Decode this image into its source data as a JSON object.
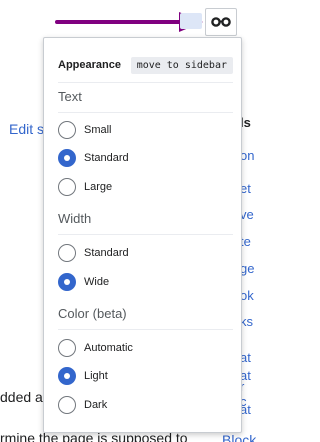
{
  "page": {
    "edit_link": "Edit so",
    "text_fragment_1": "dded a r",
    "text_fragment_2": "rmine the page is supposed to",
    "block_link": "Block",
    "right_col_heading": "ls",
    "right_col_items": [
      "on",
      "et",
      "ve",
      "te",
      "ge",
      "ok",
      "ks",
      "at",
      "at",
      "r c",
      "at"
    ]
  },
  "toggle": {
    "icon": "glasses-icon"
  },
  "annotation": {
    "arrow_color": "#800080"
  },
  "appearance": {
    "title": "Appearance",
    "pin_label": "move to sidebar",
    "sections": [
      {
        "heading": "Text",
        "options": [
          {
            "label": "Small",
            "checked": false
          },
          {
            "label": "Standard",
            "checked": true
          },
          {
            "label": "Large",
            "checked": false
          }
        ]
      },
      {
        "heading": "Width",
        "options": [
          {
            "label": "Standard",
            "checked": false
          },
          {
            "label": "Wide",
            "checked": true
          }
        ]
      },
      {
        "heading": "Color (beta)",
        "options": [
          {
            "label": "Automatic",
            "checked": false
          },
          {
            "label": "Light",
            "checked": true
          },
          {
            "label": "Dark",
            "checked": false
          }
        ]
      }
    ]
  },
  "colors": {
    "accent": "#3366cc",
    "border": "#c8ccd1",
    "heading": "#54595d"
  }
}
